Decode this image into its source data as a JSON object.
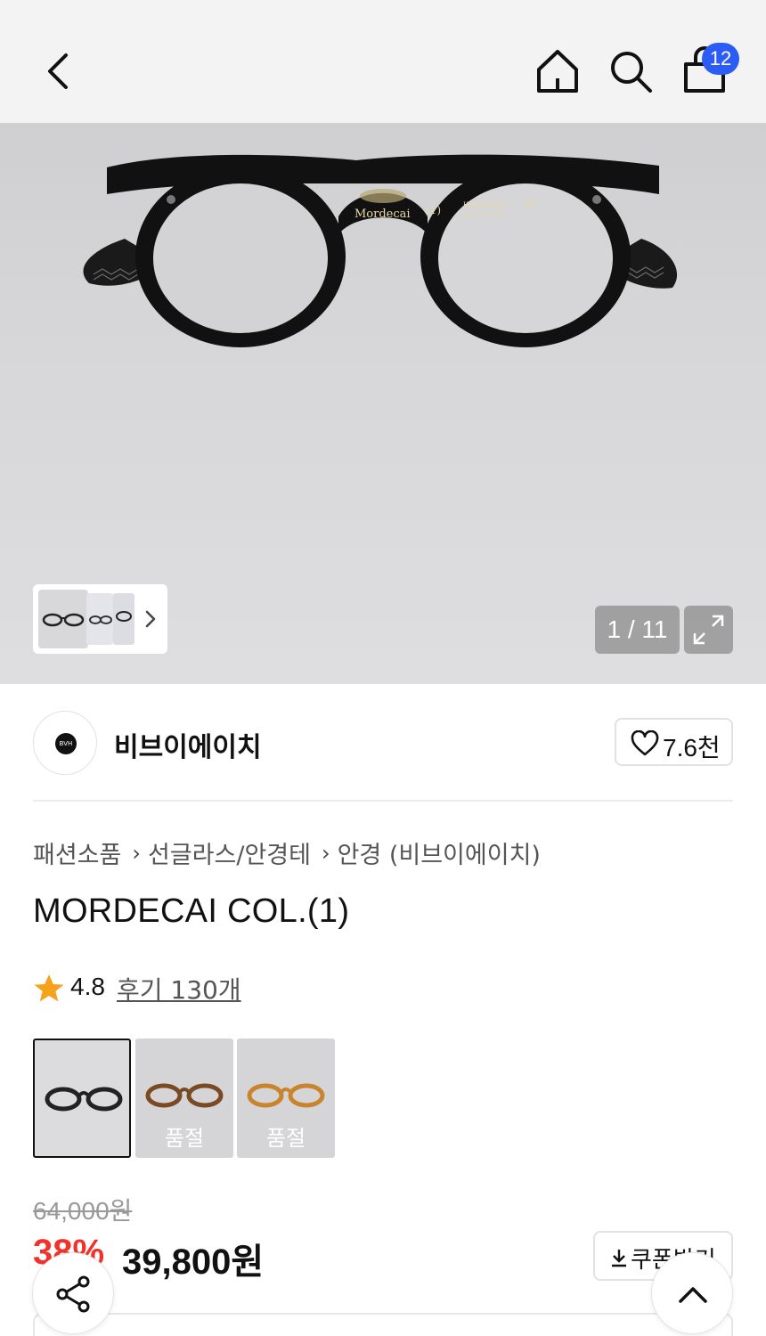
{
  "header": {
    "back_icon": "chevron-left-icon",
    "home_icon": "home-icon",
    "search_icon": "search-icon",
    "cart_icon": "shopping-bag-icon",
    "cart_count": "12",
    "badge_color": "#2b5cf5"
  },
  "gallery": {
    "temple_text": "Mordecai",
    "model_text": "(1)",
    "handmade_text": "HANDMADE",
    "size_text": "45 □ 22 148",
    "ce_text": "CE",
    "counter": "1 / 11",
    "expand_icon": "expand-icon",
    "thumbs_next_icon": "chevron-right-icon"
  },
  "brand": {
    "logo_text": "BVH",
    "name": "비브이에이치",
    "like_icon": "heart-outline-icon",
    "like_count": "7.6천"
  },
  "breadcrumb": [
    "패션소품",
    "선글라스/안경테",
    "안경 (비브이에이치)"
  ],
  "product": {
    "title": "MORDECAI COL.(1)",
    "rating": "4.8",
    "reviews_label": "후기 130개",
    "star_color": "#f7a21b"
  },
  "options": [
    {
      "label": "",
      "color": "#222222",
      "selected": true
    },
    {
      "label": "품절",
      "color": "#7a4a24",
      "selected": false
    },
    {
      "label": "품절",
      "color": "#c9842e",
      "selected": false
    }
  ],
  "price": {
    "original": "64,000원",
    "discount": "38%",
    "final": "39,800원",
    "discount_color": "#f2322a"
  },
  "coupon": {
    "icon": "download-icon",
    "label": "쿠폰받기"
  },
  "fabs": {
    "share_icon": "share-icon",
    "top_icon": "chevron-up-icon"
  }
}
